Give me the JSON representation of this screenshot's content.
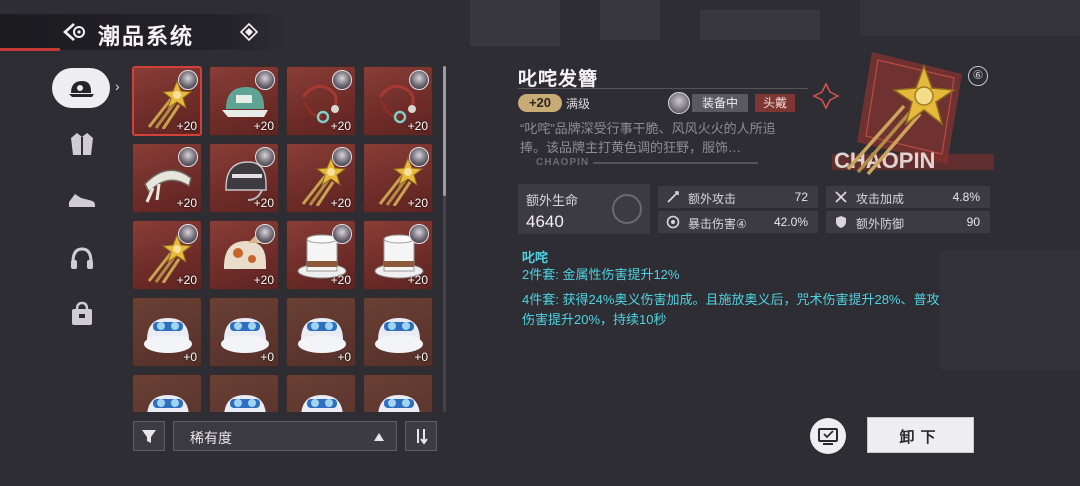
{
  "header": {
    "title": "潮品系统"
  },
  "categories": [
    {
      "name": "cap",
      "active": true
    },
    {
      "name": "jacket",
      "active": false
    },
    {
      "name": "shoes",
      "active": false
    },
    {
      "name": "headphones",
      "active": false
    },
    {
      "name": "bag",
      "active": false
    }
  ],
  "grid": {
    "items": [
      {
        "kind": "hairpin",
        "level": "+20",
        "selected": true
      },
      {
        "kind": "cap",
        "level": "+20",
        "selected": false
      },
      {
        "kind": "cord",
        "level": "+20",
        "selected": false
      },
      {
        "kind": "cord",
        "level": "+20",
        "selected": false
      },
      {
        "kind": "headband",
        "level": "+20",
        "selected": false
      },
      {
        "kind": "helmet",
        "level": "+20",
        "selected": false
      },
      {
        "kind": "hairpin",
        "level": "+20",
        "selected": false
      },
      {
        "kind": "hairpin",
        "level": "+20",
        "selected": false
      },
      {
        "kind": "hairpin",
        "level": "+20",
        "selected": false
      },
      {
        "kind": "bonnet",
        "level": "+20",
        "selected": false
      },
      {
        "kind": "tophat",
        "level": "+20",
        "selected": false
      },
      {
        "kind": "tophat",
        "level": "+20",
        "selected": false
      },
      {
        "kind": "furhat",
        "level": "+0",
        "selected": false
      },
      {
        "kind": "furhat",
        "level": "+0",
        "selected": false
      },
      {
        "kind": "furhat",
        "level": "+0",
        "selected": false
      },
      {
        "kind": "furhat",
        "level": "+0",
        "selected": false
      },
      {
        "kind": "furhat",
        "level": "",
        "selected": false
      },
      {
        "kind": "furhat",
        "level": "",
        "selected": false
      },
      {
        "kind": "furhat",
        "level": "",
        "selected": false
      },
      {
        "kind": "furhat",
        "level": "",
        "selected": false
      }
    ]
  },
  "filter": {
    "sort_label": "稀有度"
  },
  "detail": {
    "name": "叱咤发簪",
    "level": "+20",
    "max_level": "满级",
    "equip_status": "装备中",
    "slot_type": "头戴",
    "description": "“叱咤”品牌深受行事干脆、风风火火的人所追捧。该品牌主打黄色调的狂野，服饰…",
    "brand_small": "CHAOPIN",
    "brand_big": "CHAOPIN",
    "info_icon": "⑥",
    "main_stat": {
      "label": "额外生命",
      "value": "4640"
    },
    "stats": [
      {
        "icon": "attack",
        "label": "额外攻击",
        "value": "72"
      },
      {
        "icon": "attack-bonus",
        "label": "攻击加成",
        "value": "4.8%"
      },
      {
        "icon": "crit",
        "label": "暴击伤害④",
        "value": "42.0%"
      },
      {
        "icon": "shield",
        "label": "额外防御",
        "value": "90"
      }
    ],
    "set": {
      "title": "叱咤",
      "two_piece": "2件套: 金属性伤害提升12%",
      "four_piece_line1": "4件套: 获得24%奥义伤害加成。且施放奥义后，咒术伤害提升28%、普攻",
      "four_piece_line2": "伤害提升20%，持续10秒"
    },
    "unequip_label": "卸下"
  },
  "colors": {
    "accent": "#4fd3e0",
    "slot_bg": "#7a342f",
    "gold": "#c9ab76",
    "tag_red": "#7d3631"
  }
}
